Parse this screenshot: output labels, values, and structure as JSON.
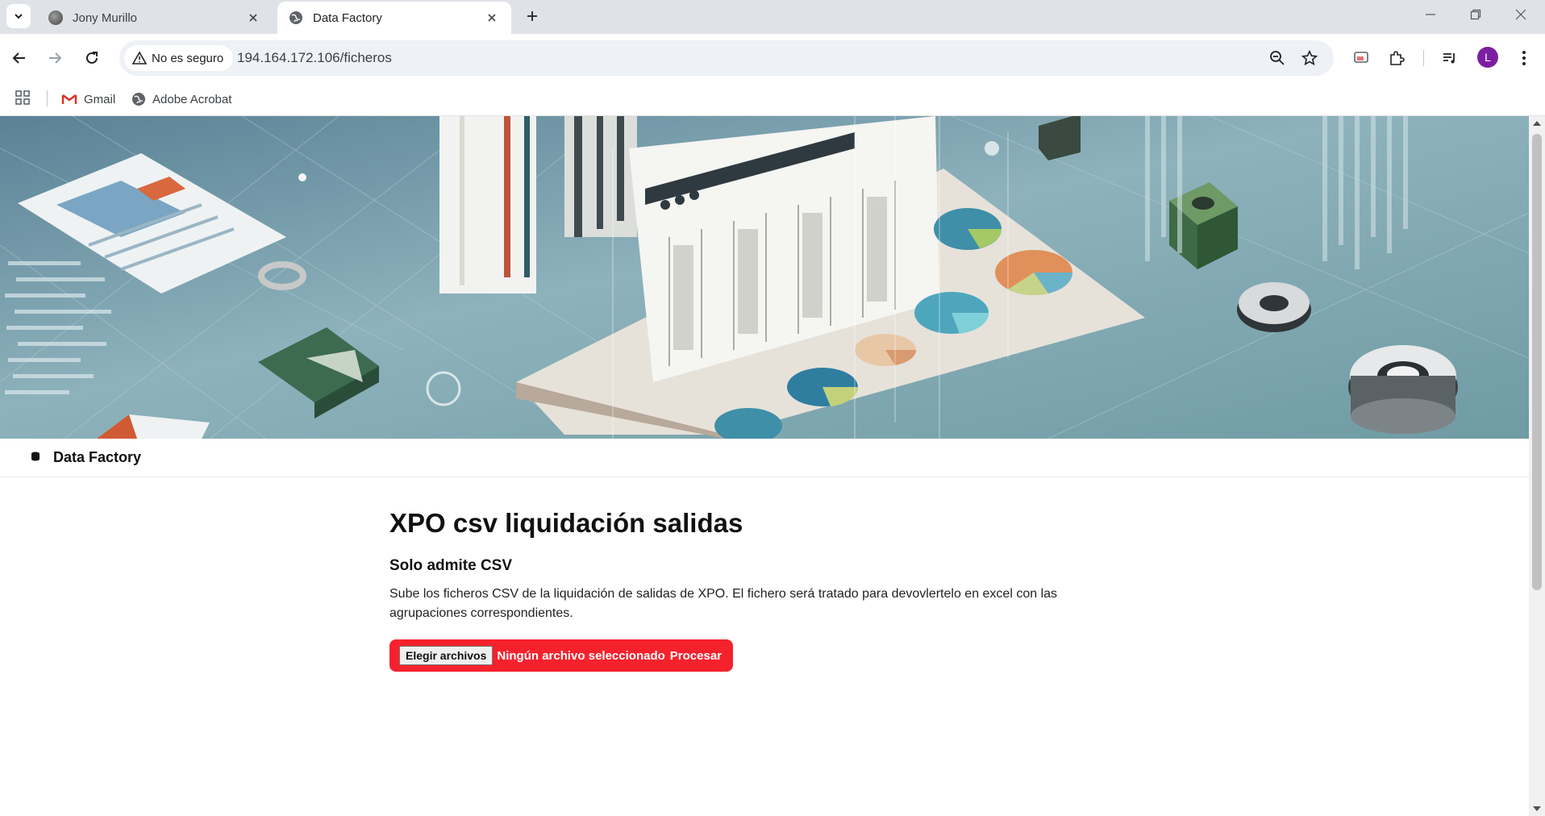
{
  "browser": {
    "tabs": [
      {
        "title": "Jony Murillo",
        "active": false
      },
      {
        "title": "Data Factory",
        "active": true
      }
    ],
    "security_chip": "No es seguro",
    "url": "194.164.172.106/ficheros",
    "profile_initial": "L",
    "bookmarks": [
      "Gmail",
      "Adobe Acrobat"
    ]
  },
  "page": {
    "brand": "Data Factory",
    "title": "XPO csv liquidación salidas",
    "subtitle": "Solo admite CSV",
    "description": "Sube los ficheros CSV de la liquidación de salidas de XPO. El fichero será tratado para devovlertelo en excel con las agrupaciones correspondientes.",
    "upload": {
      "choose_label": "Elegir archivos",
      "no_file_text": "Ningún archivo seleccionado",
      "process_label": "Procesar"
    }
  },
  "colors": {
    "accent_red": "#f5222d",
    "avatar_purple": "#7b1fa2"
  }
}
